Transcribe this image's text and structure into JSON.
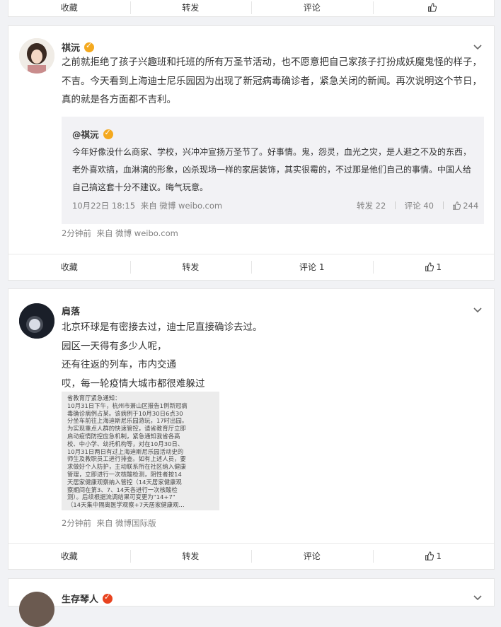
{
  "top_actions": {
    "favorite": "收藏",
    "repost": "转发",
    "comment": "评论",
    "like": ""
  },
  "post1": {
    "author": "祺沅",
    "text": "之前就拒绝了孩子兴趣班和托班的所有万圣节活动，也不愿意把自己家孩子打扮成妖魔鬼怪的样子，不吉。今天看到上海迪士尼乐园因为出现了新冠病毒确诊者，紧急关闭的新闻。再次说明这个节日，真的就是各方面都不吉利。",
    "quote": {
      "author": "@祺沅",
      "text": "今年好像没什么商家、学校，兴冲冲宣扬万圣节了。好事情。鬼，怨灵，血光之灾，是人避之不及的东西，老外喜欢搞，血淋漓的形象，凶杀现场一样的家居装饰，其实很霉的，不过那是他们自己的事情。中国人给自己搞这套十分不建议。晦气玩意。",
      "time": "10月22日 18:15",
      "source": "来自 微博 weibo.com",
      "repost": "转发 22",
      "comment": "评论 40",
      "like": "244"
    },
    "time": "2分钟前",
    "source": "来自 微博 weibo.com",
    "actions": {
      "favorite": "收藏",
      "repost": "转发",
      "comment": "评论 1",
      "like": "1"
    }
  },
  "post2": {
    "author": "肩落",
    "lines": [
      "北京环球是有密接去过，迪士尼直接确诊去过。",
      "园区一天得有多少人呢，",
      "还有往返的列车，市内交通",
      "哎，每一轮疫情大城市都很难躲过"
    ],
    "image_text": [
      "省教育厅紧急通知：",
      "10月31日下午，杭州市萧山区报告1例新冠病",
      "毒确诊病例占某。该病例于10月30日6点30",
      "分坐车前往上海迪斯尼乐园游玩，17时出园。",
      "为实现重点人群的快速管控，请省教育厅立即",
      "启动疫情防控应急机制，紧急通知我省各高",
      "校、中小学、幼托机构等，对在10月30日、",
      "10月31日两日有过上海迪斯尼乐园活动史的",
      "师生及教职员工进行排查。如有上述人员，要",
      "求做好个人防护，主动联系所在社区纳入健康",
      "管理，立即进行一次核酸检测，阴性者按14",
      "天居家健康观察纳入管控（14天居家健康观",
      "察期间在第3、7、14天各进行一次核酸检",
      "测）。后续根据流调结果可变更为\"14+7\"",
      "（14天集中隔离医学观察+7天居家健康观..."
    ],
    "time": "2分钟前",
    "source": "来自 微博国际版",
    "actions": {
      "favorite": "收藏",
      "repost": "转发",
      "comment": "评论",
      "like": "1"
    }
  },
  "post3": {
    "author": "生存琴人"
  }
}
